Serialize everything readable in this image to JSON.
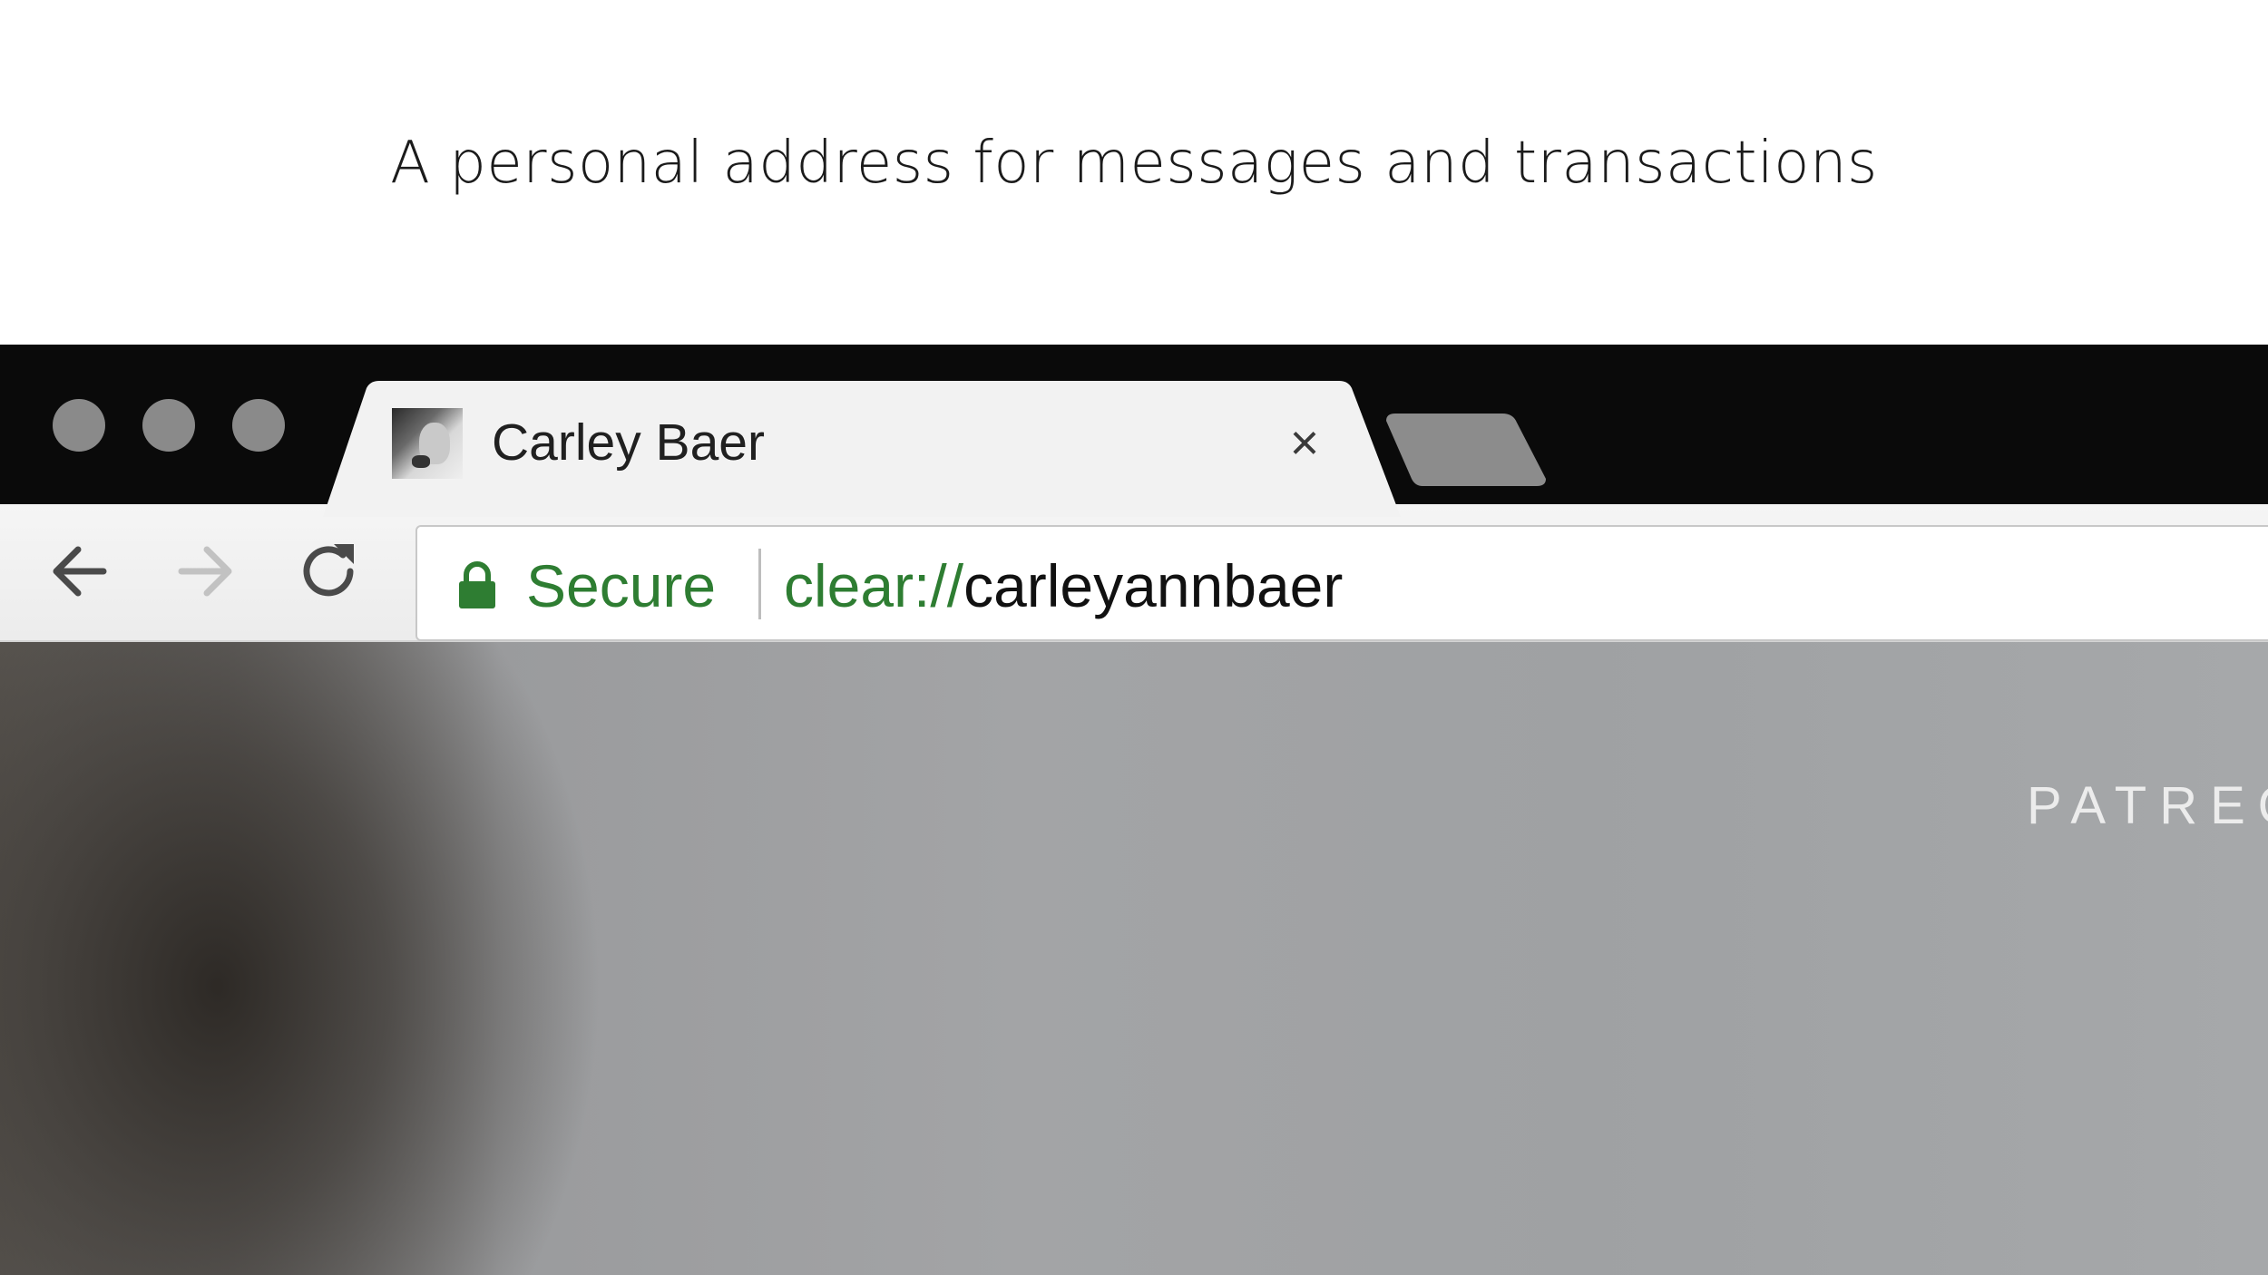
{
  "headline": "A personal address for messages and transactions",
  "browser": {
    "tab": {
      "title": "Carley Baer",
      "close_glyph": "×",
      "favicon": "portrait-photo"
    },
    "toolbar": {
      "back_icon": "arrow-left-icon",
      "forward_icon": "arrow-right-icon",
      "reload_icon": "reload-icon"
    },
    "omnibox": {
      "security_label": "Secure",
      "url_scheme": "clear://",
      "url_host": "carleyannbaer"
    },
    "page": {
      "nav_text": "PATREO"
    }
  },
  "colors": {
    "secure_green": "#2e7d32",
    "titlebar": "#0a0a0a",
    "traffic_light": "#8a8a8a"
  }
}
